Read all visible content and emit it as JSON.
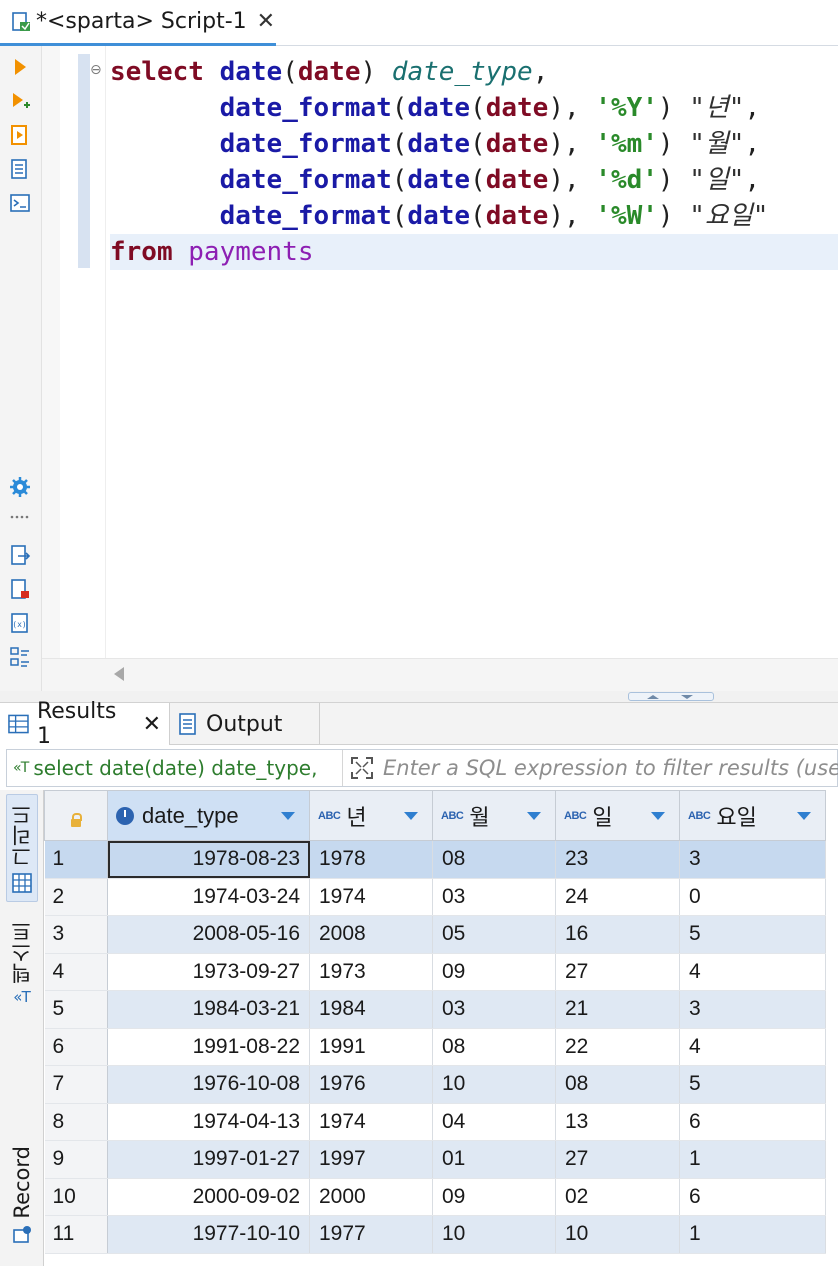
{
  "editor": {
    "tab_title": "*<sparta> Script-1",
    "tab_close": "✕",
    "tab_icon": "sql-script-icon",
    "sql": {
      "line1": {
        "kw": "select",
        "fn": "date",
        "p1": "(",
        "arg": "date",
        "p2": ")",
        "alias": "date_type",
        "comma": ","
      },
      "line2": {
        "indent": "       ",
        "fn": "date_format",
        "p1": "(",
        "fn2": "date",
        "p2": "(",
        "arg": "date",
        "p3": "),",
        "fmt": "'%Y'",
        "p4": ")",
        "alias": "\"년\"",
        "comma": ","
      },
      "line3": {
        "indent": "       ",
        "fn": "date_format",
        "p1": "(",
        "fn2": "date",
        "p2": "(",
        "arg": "date",
        "p3": "),",
        "fmt": "'%m'",
        "p4": ")",
        "alias": "\"월\"",
        "comma": ","
      },
      "line4": {
        "indent": "       ",
        "fn": "date_format",
        "p1": "(",
        "fn2": "date",
        "p2": "(",
        "arg": "date",
        "p3": "),",
        "fmt": "'%d'",
        "p4": ")",
        "alias": "\"일\"",
        "comma": ","
      },
      "line5": {
        "indent": "       ",
        "fn": "date_format",
        "p1": "(",
        "fn2": "date",
        "p2": "(",
        "arg": "date",
        "p3": "),",
        "fmt": "'%W'",
        "p4": ")",
        "alias": "\"요일\""
      },
      "line6": {
        "kw": "from",
        "table": "payments"
      }
    }
  },
  "results": {
    "tabs": [
      {
        "label": "Results 1",
        "close": "✕"
      },
      {
        "label": "Output"
      }
    ],
    "filter_query": "select date(date) date_type,",
    "filter_placeholder": "Enter a SQL expression to filter results (use",
    "side_tabs": {
      "grid": "그리드",
      "text": "텍스트",
      "record": "Record"
    },
    "columns": [
      "date_type",
      "년",
      "월",
      "일",
      "요일"
    ],
    "column_type_badges": [
      "clock-icon",
      "ABC",
      "ABC",
      "ABC",
      "ABC"
    ],
    "rows": [
      {
        "n": "1",
        "date_type": "1978-08-23",
        "y": "1978",
        "m": "08",
        "d": "23",
        "w": "3"
      },
      {
        "n": "2",
        "date_type": "1974-03-24",
        "y": "1974",
        "m": "03",
        "d": "24",
        "w": "0"
      },
      {
        "n": "3",
        "date_type": "2008-05-16",
        "y": "2008",
        "m": "05",
        "d": "16",
        "w": "5"
      },
      {
        "n": "4",
        "date_type": "1973-09-27",
        "y": "1973",
        "m": "09",
        "d": "27",
        "w": "4"
      },
      {
        "n": "5",
        "date_type": "1984-03-21",
        "y": "1984",
        "m": "03",
        "d": "21",
        "w": "3"
      },
      {
        "n": "6",
        "date_type": "1991-08-22",
        "y": "1991",
        "m": "08",
        "d": "22",
        "w": "4"
      },
      {
        "n": "7",
        "date_type": "1976-10-08",
        "y": "1976",
        "m": "10",
        "d": "08",
        "w": "5"
      },
      {
        "n": "8",
        "date_type": "1974-04-13",
        "y": "1974",
        "m": "04",
        "d": "13",
        "w": "6"
      },
      {
        "n": "9",
        "date_type": "1997-01-27",
        "y": "1997",
        "m": "01",
        "d": "27",
        "w": "1"
      },
      {
        "n": "10",
        "date_type": "2000-09-02",
        "y": "2000",
        "m": "09",
        "d": "02",
        "w": "6"
      },
      {
        "n": "11",
        "date_type": "1977-10-10",
        "y": "1977",
        "m": "10",
        "d": "10",
        "w": "1"
      }
    ]
  },
  "colors": {
    "accent": "#3f8fd8",
    "keyword": "#7f0b24",
    "function": "#1a1aa6",
    "alias": "#1a7070",
    "string": "#2a8a2a",
    "table": "#8d1fb3",
    "row_stripe": "#dfe8f3",
    "row_selected": "#c6d9ef"
  }
}
